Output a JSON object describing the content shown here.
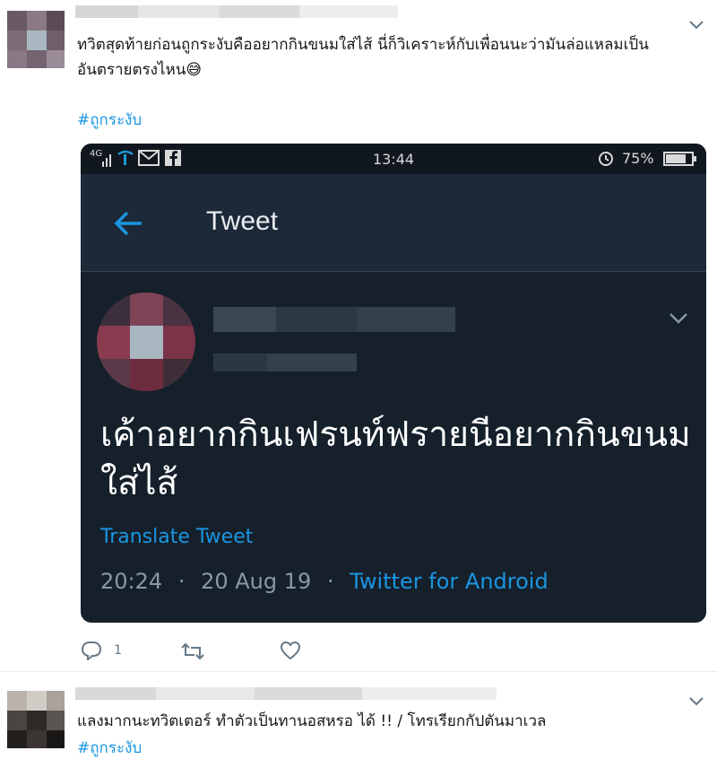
{
  "tweet1": {
    "text_line1": "ทวิตสุดท้ายก่อนถูกระงับคืออยากกินขนมใส่ไส้ นี่ก็วิเคราะห์กับเพื่อนนะว่ามันล่อแหลมเป็น",
    "text_line2": "อันตรายตรงไหน",
    "emoji": "😅",
    "hashtag": "#ถูกระงับ",
    "reply_count": "1"
  },
  "screenshot": {
    "status_time": "13:44",
    "status_network": "4G",
    "battery": "75%",
    "appbar_title": "Tweet",
    "quoted_text": "เค้าอยากกินเฟรนท์ฟรายนีอยากกินขนมใส่ไส้",
    "translate_label": "Translate Tweet",
    "time": "20:24",
    "date": "20 Aug 19",
    "dot": "·",
    "source": "Twitter for Android"
  },
  "tweet2": {
    "text": "แลงมากนะทวิตเตอร์ ทำตัวเป็นทานอสหรอ ได้ !! / โทรเรียกกัปตันมาเวล",
    "hashtag": "#ถูกระงับ"
  },
  "colors": {
    "accent": "#1b95e0",
    "dark_bg": "#15202b",
    "appbar_bg": "#1c2938"
  },
  "icons": [
    "chevron-down-icon",
    "back-arrow-icon",
    "reply-icon",
    "retweet-icon",
    "like-icon",
    "alarm-icon",
    "battery-icon"
  ]
}
